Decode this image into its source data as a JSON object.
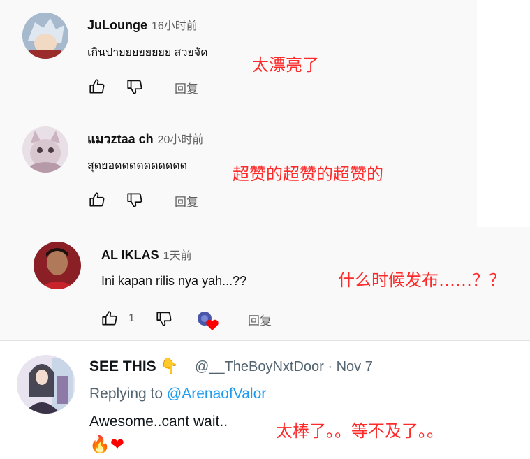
{
  "comments": [
    {
      "author": "JuLounge",
      "time": "16小时前",
      "text": "เกินปายยยยยยยย สวยจัด",
      "annotation": "太漂亮了",
      "reply_label": "回复"
    },
    {
      "author": "แมวztaa ch",
      "time": "20小时前",
      "text": "สุดยอดดดดดดดดดด",
      "annotation": "超赞的超赞的超赞的",
      "reply_label": "回复"
    },
    {
      "author": "AL IKLAS",
      "time": "1天前",
      "text": "Ini kapan rilis nya yah...??",
      "annotation": "什么时候发布……？？",
      "like_count": "1",
      "reply_label": "回复"
    }
  ],
  "tweet": {
    "name": "SEE THIS",
    "handle_date": "@__TheBoyNxtDoor · Nov 7",
    "replying_prefix": "Replying to",
    "replying_handle": "@ArenaofValor",
    "text": "Awesome..cant wait..",
    "annotation": "太棒了。。等不及了。。",
    "emoji": "🔥❤"
  },
  "colors": {
    "annotation": "#ff2a2a",
    "link": "#1d9bf0",
    "heart": "#ff0000"
  }
}
